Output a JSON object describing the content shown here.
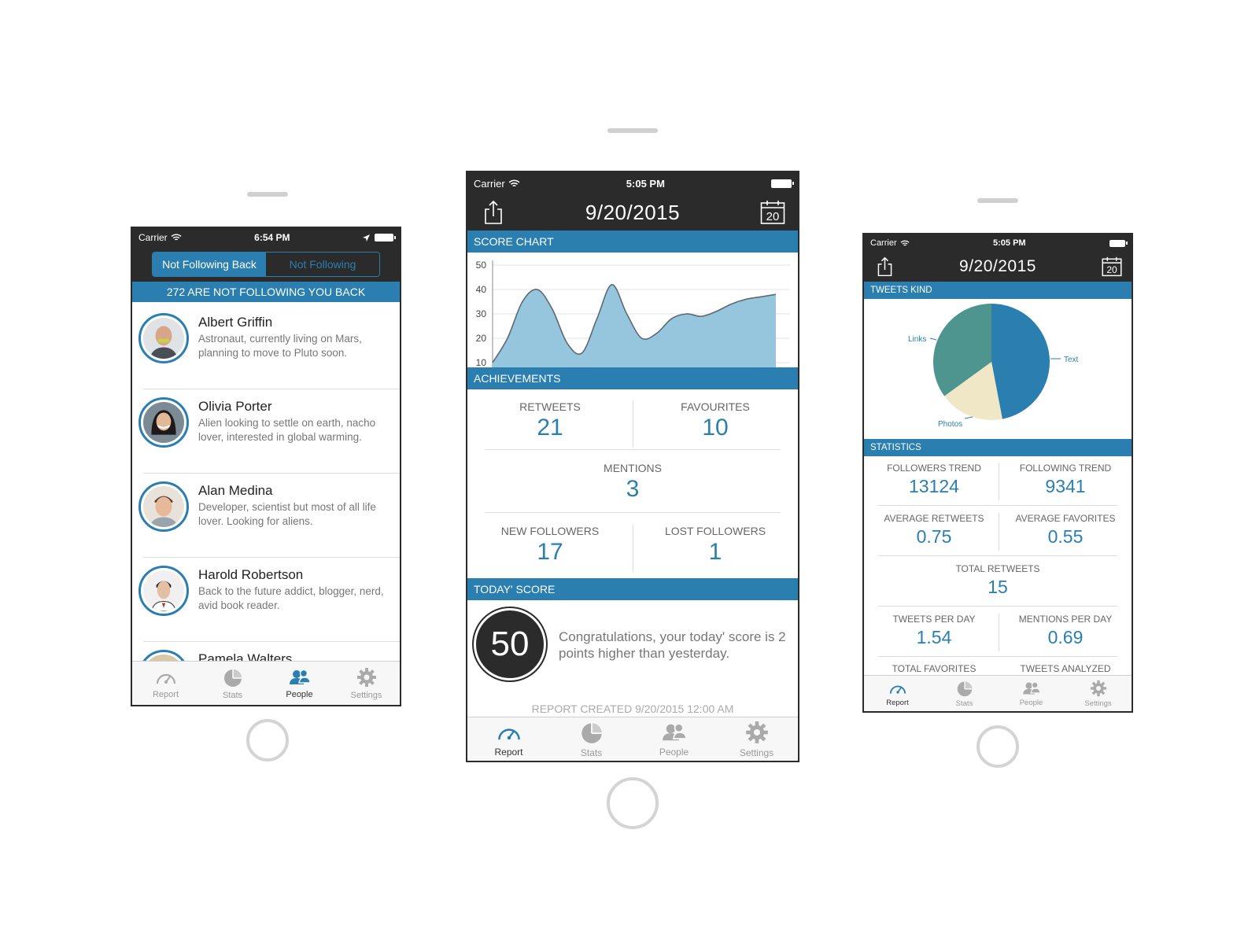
{
  "colors": {
    "accent": "#2a7fb0",
    "dark": "#2b2b2b",
    "teal": "#4e948f",
    "cream": "#efe7c6"
  },
  "tabs": [
    {
      "label": "Report",
      "icon": "gauge-icon"
    },
    {
      "label": "Stats",
      "icon": "pie-chart-icon"
    },
    {
      "label": "People",
      "icon": "people-icon"
    },
    {
      "label": "Settings",
      "icon": "gear-icon"
    }
  ],
  "people_screen": {
    "status": {
      "carrier": "Carrier",
      "time": "6:54 PM"
    },
    "segments": [
      "Not Following Back",
      "Not Following"
    ],
    "count_banner": "272 ARE NOT FOLLOWING YOU BACK",
    "people": [
      {
        "name": "Albert Griffin",
        "bio": "Astronaut, currently living on Mars, planning to move to Pluto soon."
      },
      {
        "name": "Olivia Porter",
        "bio": "Alien looking to settle on earth, nacho lover, interested in global warming."
      },
      {
        "name": "Alan Medina",
        "bio": "Developer, scientist but most of all life lover. Looking for aliens."
      },
      {
        "name": "Harold Robertson",
        "bio": "Back to the future addict, blogger, nerd, avid book reader."
      },
      {
        "name": "Pamela Walters",
        "bio": ""
      }
    ]
  },
  "report_screen": {
    "status": {
      "carrier": "Carrier",
      "time": "5:05 PM"
    },
    "title": "9/20/2015",
    "calendar_day": "20",
    "score_chart_header": "SCORE CHART",
    "achievements_header": "ACHIEVEMENTS",
    "achievements": {
      "retweets": {
        "label": "RETWEETS",
        "value": "21"
      },
      "favourites": {
        "label": "FAVOURITES",
        "value": "10"
      },
      "mentions": {
        "label": "MENTIONS",
        "value": "3"
      },
      "new_followers": {
        "label": "NEW FOLLOWERS",
        "value": "17"
      },
      "lost_followers": {
        "label": "LOST FOLLOWERS",
        "value": "1"
      }
    },
    "today_header": "TODAY' SCORE",
    "score": "50",
    "score_message": "Congratulations, your today' score is 2 points higher than yesterday.",
    "report_created": "REPORT CREATED 9/20/2015 12:00 AM"
  },
  "stats_screen": {
    "status": {
      "carrier": "Carrier",
      "time": "5:05 PM"
    },
    "title": "9/20/2015",
    "calendar_day": "20",
    "tweets_kind_header": "TWEETS KIND",
    "pie_labels": {
      "links": "Links",
      "text": "Text",
      "photos": "Photos"
    },
    "statistics_header": "STATISTICS",
    "stats": {
      "followers_trend": {
        "label": "FOLLOWERS TREND",
        "value": "13124"
      },
      "following_trend": {
        "label": "FOLLOWING TREND",
        "value": "9341"
      },
      "average_retweets": {
        "label": "AVERAGE RETWEETS",
        "value": "0.75"
      },
      "average_favorites": {
        "label": "AVERAGE FAVORITES",
        "value": "0.55"
      },
      "total_retweets": {
        "label": "TOTAL RETWEETS",
        "value": "15"
      },
      "tweets_per_day": {
        "label": "TWEETS PER DAY",
        "value": "1.54"
      },
      "mentions_per_day": {
        "label": "MENTIONS PER DAY",
        "value": "0.69"
      },
      "total_favorites": {
        "label": "TOTAL FAVORITES",
        "value": ""
      },
      "tweets_analyzed": {
        "label": "TWEETS ANALYZED",
        "value": ""
      }
    }
  },
  "chart_data": [
    {
      "type": "area",
      "title": "SCORE CHART",
      "ylim": [
        10,
        50
      ],
      "yticks": [
        10,
        20,
        30,
        40,
        50
      ],
      "grid": true,
      "series": [
        {
          "values": [
            10,
            20,
            35,
            40,
            32,
            18,
            14,
            28,
            42,
            30,
            20,
            22,
            28,
            30,
            29,
            31,
            34,
            36,
            37,
            38
          ]
        }
      ]
    },
    {
      "type": "pie",
      "title": "TWEETS KIND",
      "slices": [
        {
          "label": "Text",
          "value": 47,
          "color": "#2a7fb0"
        },
        {
          "label": "Photos",
          "value": 18,
          "color": "#efe7c6"
        },
        {
          "label": "Links",
          "value": 35,
          "color": "#4e948f"
        }
      ]
    }
  ]
}
